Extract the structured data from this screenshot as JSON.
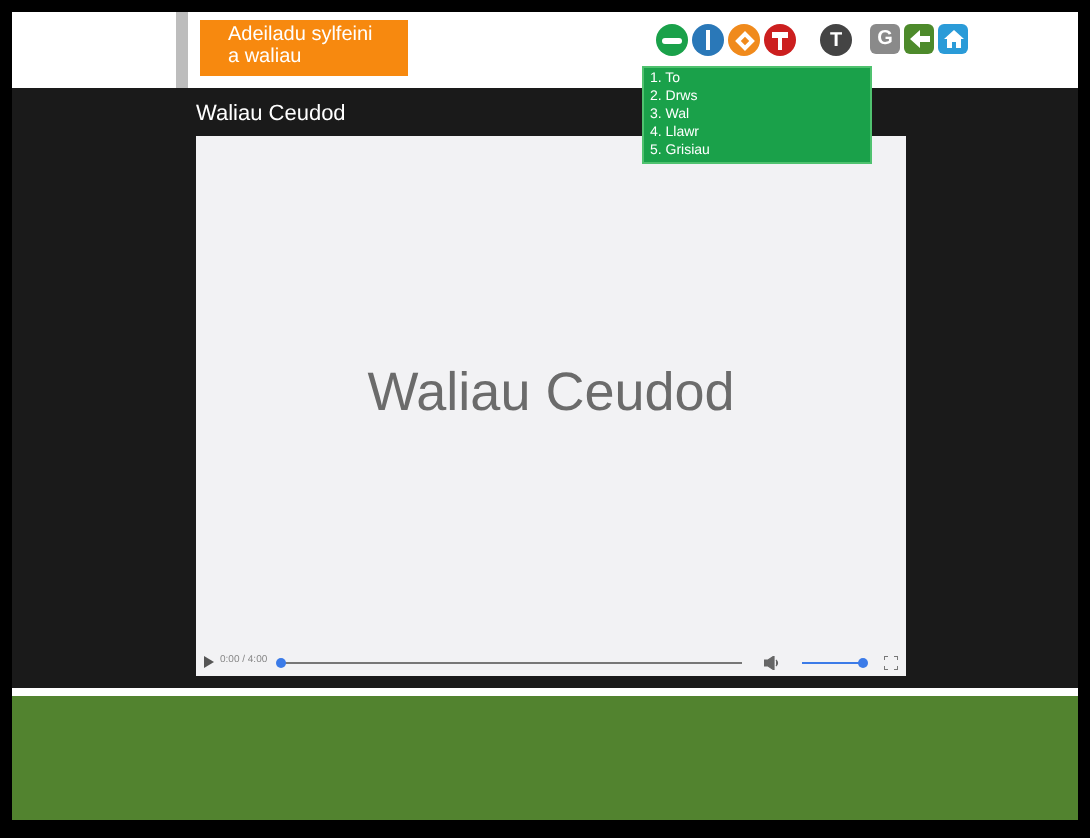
{
  "header": {
    "topic_tag": "Adeiladu sylfeini a waliau",
    "tool_letter": "T",
    "nav_letter": "G"
  },
  "menu": {
    "items": [
      "1. To",
      "2. Drws",
      "3. Wal",
      "4. Llawr",
      "5. Grisiau"
    ]
  },
  "video": {
    "title": "Waliau Ceudod",
    "slide_text": "Waliau Ceudod",
    "time": "0:00 / 4:00",
    "progress": {
      "level": 0
    },
    "volume": {
      "level": 1
    }
  }
}
